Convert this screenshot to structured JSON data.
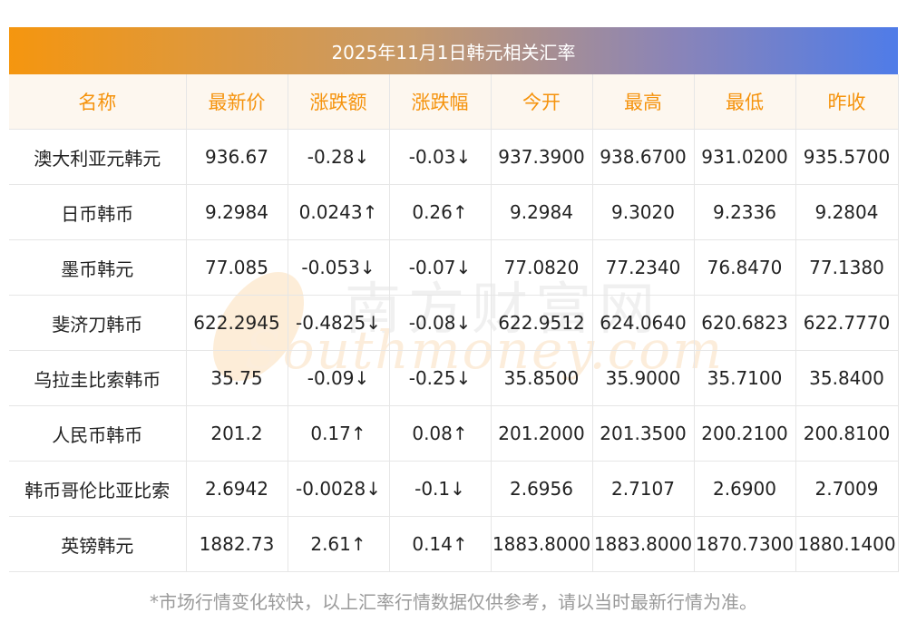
{
  "title": "2025年11月1日韩元相关汇率",
  "columns": [
    "名称",
    "最新价",
    "涨跌额",
    "涨跌幅",
    "今开",
    "最高",
    "最低",
    "昨收"
  ],
  "rows": [
    {
      "name": "澳大利亚元韩元",
      "last": "936.67",
      "change": "-0.28↓",
      "pct": "-0.03↓",
      "open": "937.3900",
      "high": "938.6700",
      "low": "931.0200",
      "prev": "935.5700",
      "dir": "down"
    },
    {
      "name": "日币韩币",
      "last": "9.2984",
      "change": "0.0243↑",
      "pct": "0.26↑",
      "open": "9.2984",
      "high": "9.3020",
      "low": "9.2336",
      "prev": "9.2804",
      "dir": "up"
    },
    {
      "name": "墨币韩元",
      "last": "77.085",
      "change": "-0.053↓",
      "pct": "-0.07↓",
      "open": "77.0820",
      "high": "77.2340",
      "low": "76.8470",
      "prev": "77.1380",
      "dir": "down"
    },
    {
      "name": "斐济刀韩币",
      "last": "622.2945",
      "change": "-0.4825↓",
      "pct": "-0.08↓",
      "open": "622.9512",
      "high": "624.0640",
      "low": "620.6823",
      "prev": "622.7770",
      "dir": "down"
    },
    {
      "name": "乌拉圭比索韩币",
      "last": "35.75",
      "change": "-0.09↓",
      "pct": "-0.25↓",
      "open": "35.8500",
      "high": "35.9000",
      "low": "35.7100",
      "prev": "35.8400",
      "dir": "down"
    },
    {
      "name": "人民币韩币",
      "last": "201.2",
      "change": "0.17↑",
      "pct": "0.08↑",
      "open": "201.2000",
      "high": "201.3500",
      "low": "200.2100",
      "prev": "200.8100",
      "dir": "up"
    },
    {
      "name": "韩币哥伦比亚比索",
      "last": "2.6942",
      "change": "-0.0028↓",
      "pct": "-0.1↓",
      "open": "2.6956",
      "high": "2.7107",
      "low": "2.6900",
      "prev": "2.7009",
      "dir": "down"
    },
    {
      "name": "英镑韩元",
      "last": "1882.73",
      "change": "2.61↑",
      "pct": "0.14↑",
      "open": "1883.8000",
      "high": "1883.8000",
      "low": "1870.7300",
      "prev": "1880.1400",
      "dir": "up"
    }
  ],
  "footnote": "*市场行情变化较快，以上汇率行情数据仅供参考，请以当时最新行情为准。",
  "watermark": {
    "cn": "南方财富网",
    "en": "Southmoney.com"
  },
  "colors": {
    "header_text": "#f5930d",
    "up": "#e8201c",
    "down": "#1f8a1f"
  }
}
